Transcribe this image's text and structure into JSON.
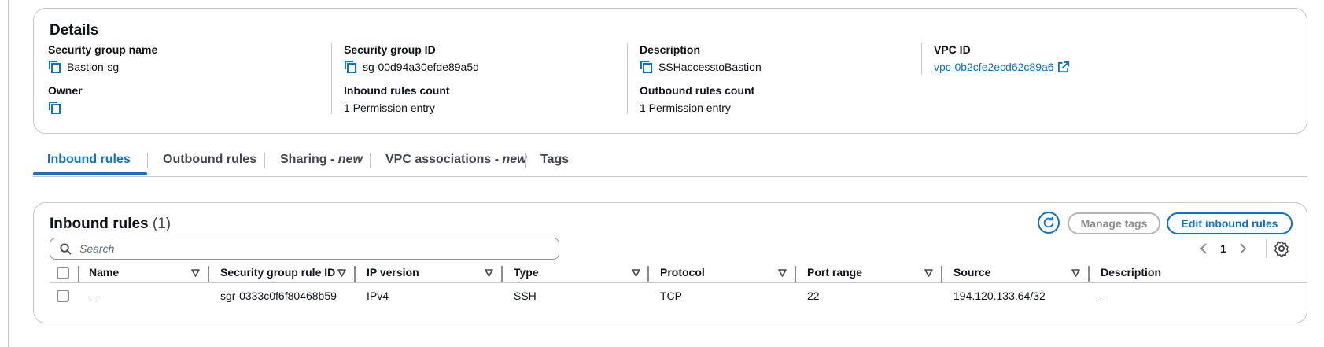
{
  "details": {
    "title": "Details",
    "security_group_name_label": "Security group name",
    "security_group_name": "Bastion-sg",
    "security_group_id_label": "Security group ID",
    "security_group_id": "sg-00d94a30efde89a5d",
    "description_label": "Description",
    "description": "SSHaccesstoBastion",
    "vpc_id_label": "VPC ID",
    "vpc_id": "vpc-0b2cfe2ecd62c89a6",
    "owner_label": "Owner",
    "owner": "",
    "inbound_rules_count_label": "Inbound rules count",
    "inbound_rules_count": "1 Permission entry",
    "outbound_rules_count_label": "Outbound rules count",
    "outbound_rules_count": "1 Permission entry"
  },
  "tabs": [
    {
      "label": "Inbound rules",
      "suffix": "",
      "active": true
    },
    {
      "label": "Outbound rules",
      "suffix": "",
      "active": false
    },
    {
      "label": "Sharing - ",
      "suffix": "new",
      "active": false
    },
    {
      "label": "VPC associations - ",
      "suffix": "new",
      "active": false
    },
    {
      "label": "Tags",
      "suffix": "",
      "active": false
    }
  ],
  "inbound": {
    "title": "Inbound rules",
    "count": "(1)",
    "manage_tags_label": "Manage tags",
    "edit_label": "Edit inbound rules",
    "search_placeholder": "Search",
    "page": "1",
    "columns": [
      "Name",
      "Security group rule ID",
      "IP version",
      "Type",
      "Protocol",
      "Port range",
      "Source",
      "Description"
    ],
    "rows": [
      {
        "name": "–",
        "rule_id": "sgr-0333c0f6f80468b59",
        "ip_version": "IPv4",
        "type": "SSH",
        "protocol": "TCP",
        "port_range": "22",
        "source": "194.120.133.64/32",
        "description": "–"
      }
    ]
  },
  "colors": {
    "accent": "#0972d3",
    "border": "#c6c6cd",
    "text": "#0f141a",
    "disabled": "#8c8c94"
  },
  "icons": [
    "copy-icon",
    "external-link-icon",
    "refresh-icon",
    "search-icon",
    "chevron-left-icon",
    "chevron-right-icon",
    "settings-icon",
    "sort-icon"
  ]
}
